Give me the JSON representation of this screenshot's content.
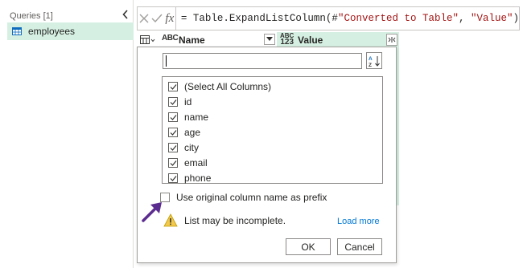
{
  "queries_pane": {
    "header": "Queries [1]",
    "items": [
      {
        "label": "employees"
      }
    ]
  },
  "formula_bar": {
    "fx_label": "fx",
    "prefix": "= Table.ExpandListColumn(#",
    "string1": "\"Converted to Table\"",
    "middle": ", ",
    "string2": "\"Value\"",
    "suffix": ")"
  },
  "grid_header": {
    "columns": [
      {
        "type_label": "ABC",
        "name": "Name"
      },
      {
        "type_label_top": "ABC",
        "type_label_bottom": "123",
        "name": "Value"
      }
    ]
  },
  "expand_popup": {
    "search": {
      "value": "",
      "placeholder": ""
    },
    "columns": [
      {
        "label": "(Select All Columns)",
        "checked": true
      },
      {
        "label": "id",
        "checked": true
      },
      {
        "label": "name",
        "checked": true
      },
      {
        "label": "age",
        "checked": true
      },
      {
        "label": "city",
        "checked": true
      },
      {
        "label": "email",
        "checked": true
      },
      {
        "label": "phone",
        "checked": true
      }
    ],
    "prefix_option": {
      "label": "Use original column name as prefix",
      "checked": false
    },
    "warning": "List may be incomplete.",
    "load_more_label": "Load more",
    "ok_label": "OK",
    "cancel_label": "Cancel"
  },
  "colors": {
    "selection_green": "#d5f0e3",
    "annotation_arrow": "#5b2c8f",
    "link_blue": "#0078d4",
    "warning_yellow": "#f2c94c"
  },
  "icons": {
    "table": "table-icon",
    "collapse": "chevron-left-icon",
    "cancel": "close-icon",
    "confirm": "checkmark-icon",
    "sort": "sort-az-icon",
    "warning": "warning-icon",
    "expand": "expand-columns-icon"
  }
}
